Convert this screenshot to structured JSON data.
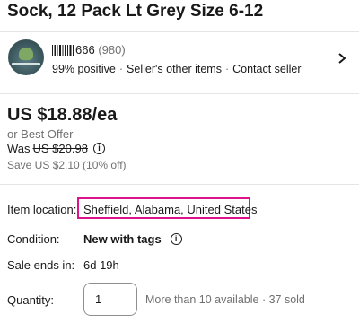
{
  "item": {
    "title": "Sock, 12 Pack Lt Grey Size 6-12"
  },
  "seller": {
    "name_suffix": "666",
    "feedback_count": "(980)",
    "positive_link": "99% positive",
    "other_items_link": "Seller's other items",
    "contact_link": "Contact seller"
  },
  "pricing": {
    "price": "US $18.88/ea",
    "best_offer": "or Best Offer",
    "was_label": "Was",
    "was_price": "US $20.98",
    "save_text": "Save US $2.10 (10% off)"
  },
  "details": {
    "location_label": "Item location:",
    "location_value": "Sheffield, Alabama, United States",
    "condition_label": "Condition:",
    "condition_value": "New with tags",
    "ends_label": "Sale ends in:",
    "ends_value": "6d 19h",
    "quantity_label": "Quantity:",
    "quantity_value": "1",
    "availability": "More than 10 available · 37 sold"
  },
  "colors": {
    "highlight": "#e0128a",
    "muted": "#707070"
  }
}
